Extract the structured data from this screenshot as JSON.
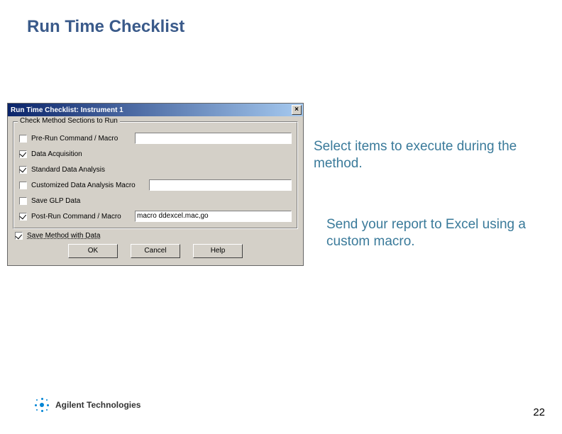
{
  "slide": {
    "title": "Run Time Checklist",
    "page_number": "22"
  },
  "dialog": {
    "title": "Run Time Checklist: Instrument 1",
    "close": "×",
    "group_label": "Check Method Sections to Run",
    "items": [
      {
        "label": "Pre-Run Command / Macro",
        "checked": false,
        "has_field": true,
        "value": ""
      },
      {
        "label": "Data Acquisition",
        "checked": true,
        "has_field": false
      },
      {
        "label": "Standard Data Analysis",
        "checked": true,
        "has_field": false
      },
      {
        "label": "Customized Data Analysis Macro",
        "checked": false,
        "has_field": true,
        "value": ""
      },
      {
        "label": "Save GLP Data",
        "checked": false,
        "has_field": false
      },
      {
        "label": "Post-Run Command / Macro",
        "checked": true,
        "has_field": true,
        "value": "macro ddexcel.mac,go"
      }
    ],
    "save_with_data": {
      "label": "Save Method with Data",
      "checked": true
    },
    "buttons": {
      "ok": "OK",
      "cancel": "Cancel",
      "help": "Help"
    }
  },
  "callouts": {
    "c1": "Select items to execute during the method.",
    "c2": "Send your report to Excel using a custom macro."
  },
  "logo": {
    "text": "Agilent Technologies"
  }
}
